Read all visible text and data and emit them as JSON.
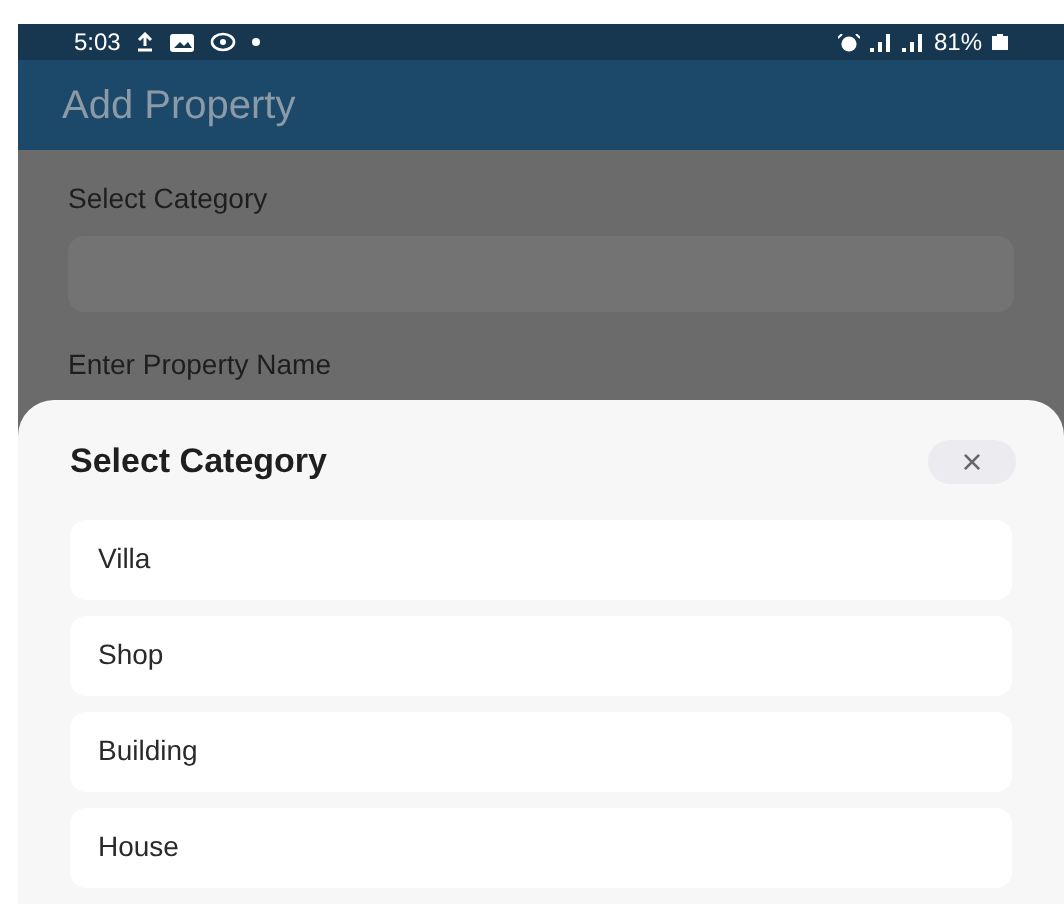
{
  "status_bar": {
    "time": "5:03",
    "battery": "81%"
  },
  "app_bar": {
    "title": "Add Property"
  },
  "form": {
    "fields": [
      {
        "label": "Select Category"
      },
      {
        "label": "Enter Property Name"
      }
    ]
  },
  "sheet": {
    "title": "Select Category",
    "close": "×",
    "options": [
      {
        "label": "Villa"
      },
      {
        "label": "Shop"
      },
      {
        "label": "Building"
      },
      {
        "label": "House"
      }
    ]
  }
}
